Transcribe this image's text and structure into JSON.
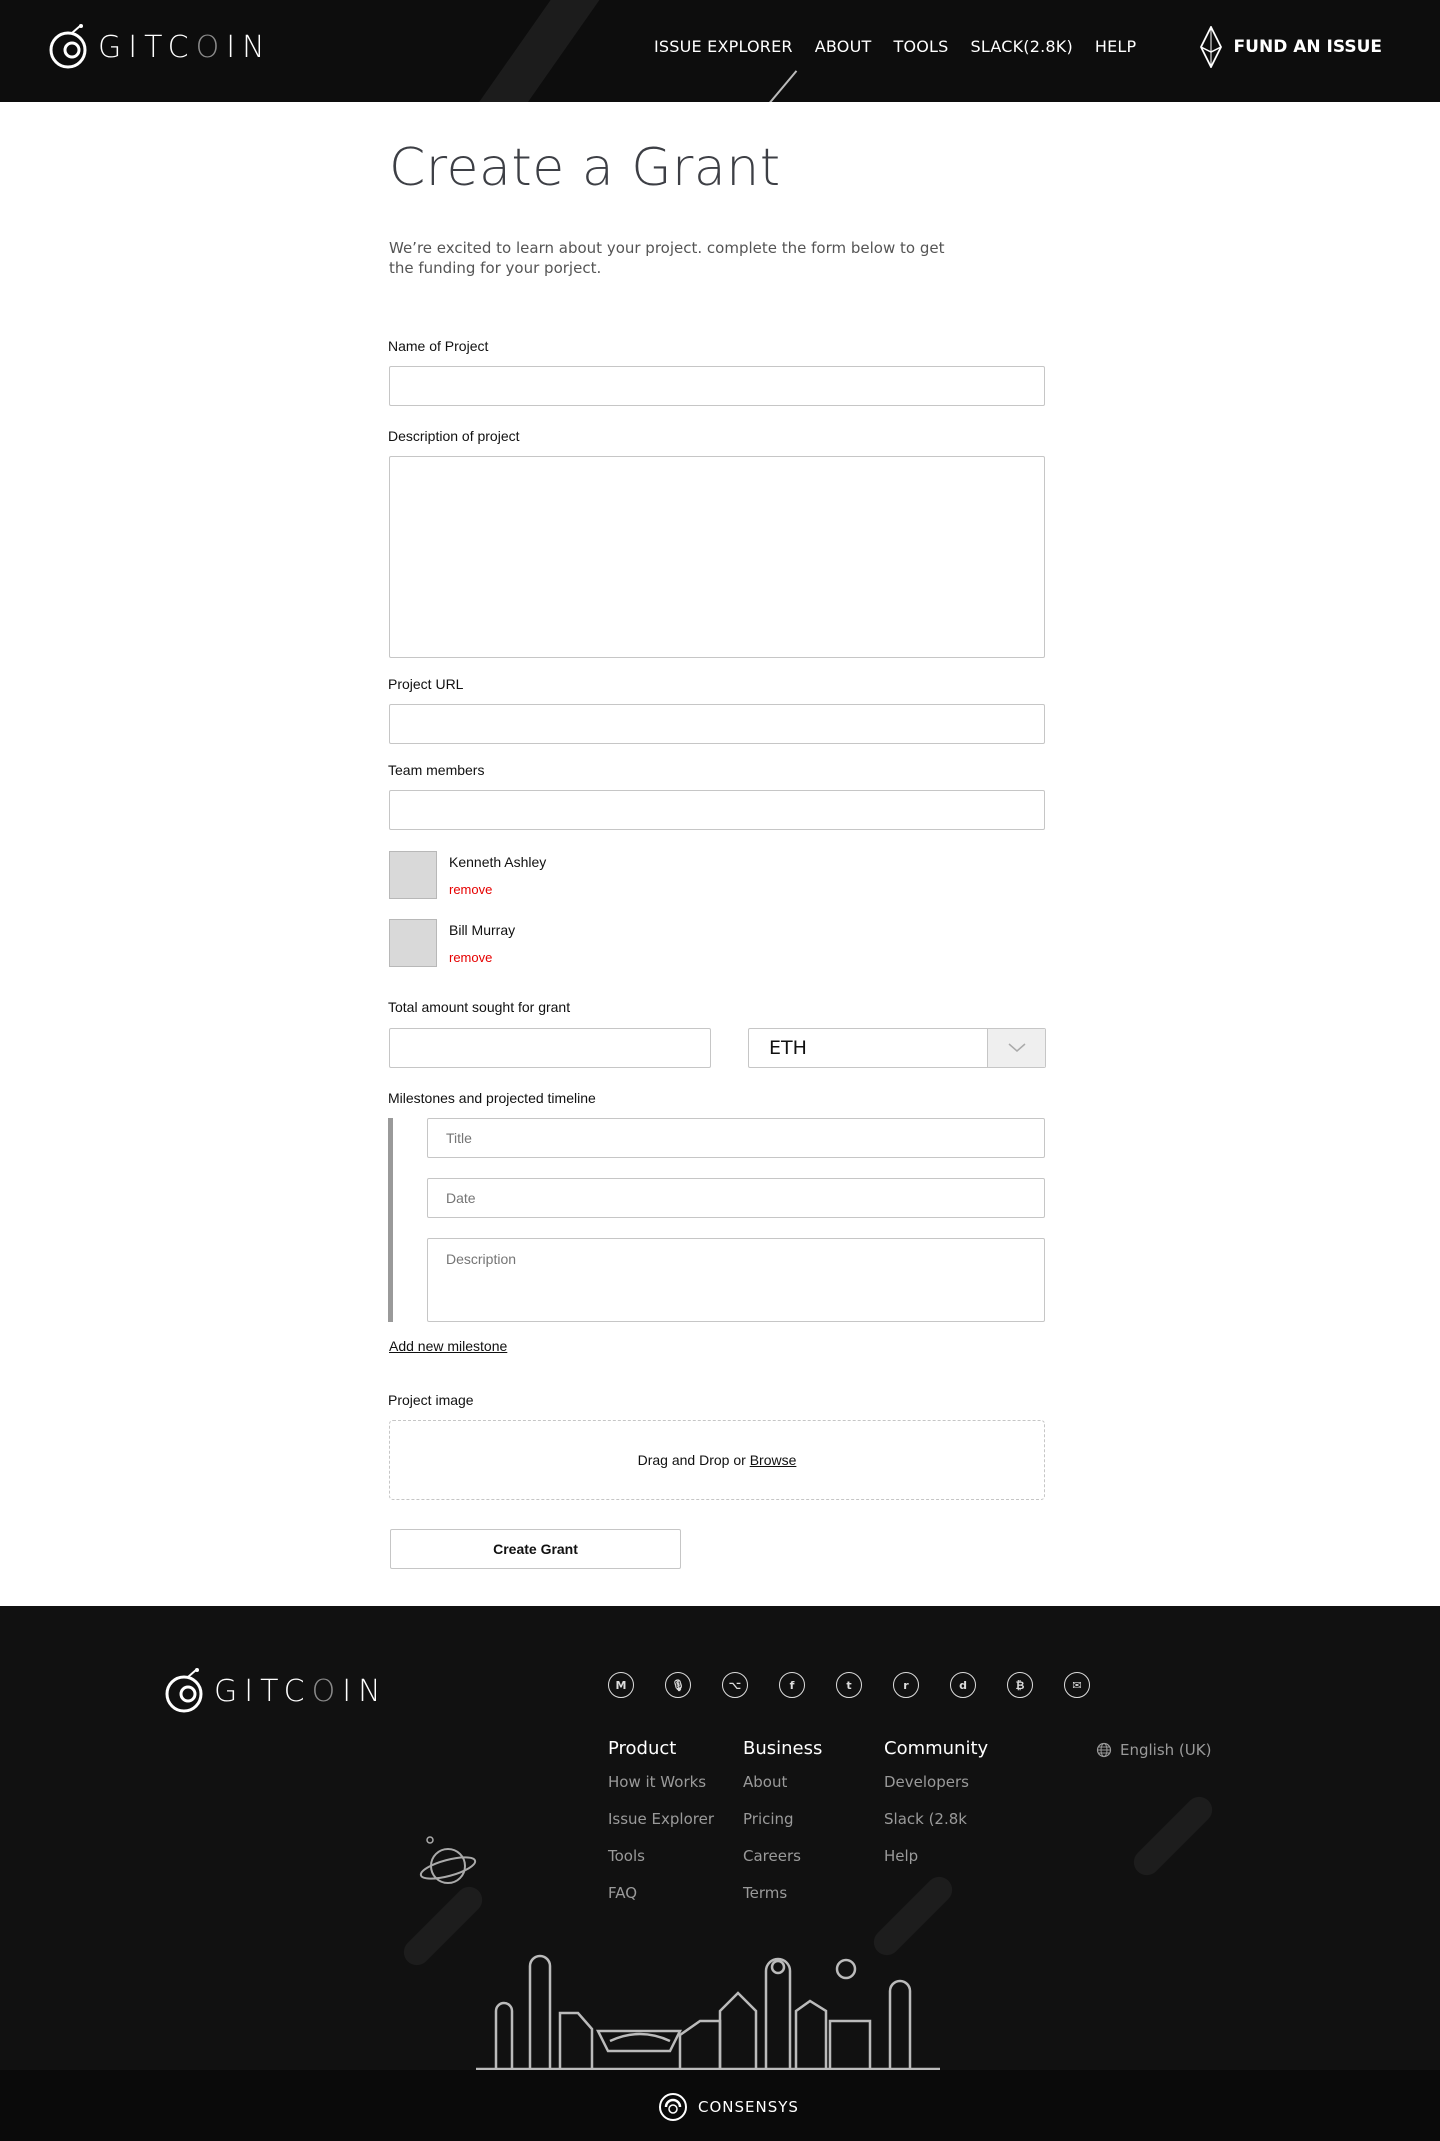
{
  "header": {
    "brand": "GITCOIN",
    "nav": [
      "ISSUE EXPLORER",
      "ABOUT",
      "TOOLS",
      "SLACK(2.8K)",
      "HELP"
    ],
    "cta": "FUND AN ISSUE"
  },
  "form": {
    "title": "Create a Grant",
    "intro": "We’re excited to learn about your project. complete the form below to get the funding for your porject.",
    "name_label": "Name of Project",
    "name_value": "",
    "description_label": "Description of project",
    "description_value": "",
    "url_label": "Project URL",
    "url_value": "",
    "team_label": "Team members",
    "team_value": "",
    "members": [
      {
        "name": "Kenneth Ashley",
        "action": "remove"
      },
      {
        "name": "Bill Murray",
        "action": "remove"
      }
    ],
    "amount_label": "Total amount sought for grant",
    "amount_value": "",
    "currency": "ETH",
    "milestones_label": "Milestones and projected timeline",
    "milestone_title_placeholder": "Title",
    "milestone_date_placeholder": "Date",
    "milestone_description_placeholder": "Description",
    "add_milestone": "Add new milestone",
    "image_label": "Project image",
    "drop_text": "Drag and Drop or ",
    "drop_browse": "Browse",
    "submit": "Create Grant"
  },
  "footer": {
    "brand": "GITCOIN",
    "social_icons": [
      "medium-icon",
      "podcast-icon",
      "github-icon",
      "facebook-icon",
      "twitter-icon",
      "reddit-icon",
      "discourse-icon",
      "bitcoin-icon",
      "mail-icon"
    ],
    "social_glyphs": [
      "M",
      "🎙",
      "⌥",
      "f",
      "t",
      "r",
      "d",
      "₿",
      "✉"
    ],
    "columns": [
      {
        "heading": "Product",
        "items": [
          "How it Works",
          "Issue Explorer",
          "Tools",
          "FAQ"
        ]
      },
      {
        "heading": "Business",
        "items": [
          "About",
          "Pricing",
          "Careers",
          "Terms"
        ]
      },
      {
        "heading": "Community",
        "items": [
          "Developers",
          "Slack (2.8k",
          "Help"
        ]
      }
    ],
    "language": "English (UK)",
    "partner": "CONSENSYS"
  },
  "colors": {
    "header_bg": "#0d0d0d",
    "footer_bg": "#111111",
    "remove_link": "#e60000",
    "milestone_bar": "#9a9a9a"
  }
}
